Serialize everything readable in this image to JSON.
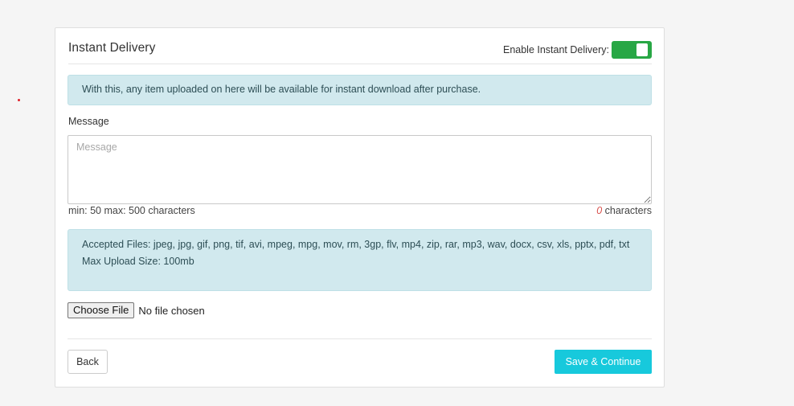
{
  "card": {
    "title": "Instant Delivery",
    "toggle_label": "Enable Instant Delivery:",
    "toggle_on": true,
    "accent_color": "#28a745"
  },
  "info_notice": "With this, any item uploaded on here will be available for instant download after purchase.",
  "message": {
    "label": "Message",
    "placeholder": "Message",
    "value": "",
    "limits_hint": "min: 50 max: 500 characters",
    "char_count": "0",
    "char_suffix": "characters"
  },
  "upload_info": {
    "accepted_files": "Accepted Files: jpeg, jpg, gif, png, tif, avi, mpeg, mpg, mov, rm, 3gp, flv, mp4, zip, rar, mp3, wav, docx, csv, xls, pptx, pdf, txt",
    "max_size": "Max Upload Size: 100mb"
  },
  "file_input": {
    "button_label": "Choose File",
    "status": "No file chosen"
  },
  "footer": {
    "back_label": "Back",
    "save_label": "Save & Continue",
    "save_color": "#17c9dc"
  }
}
